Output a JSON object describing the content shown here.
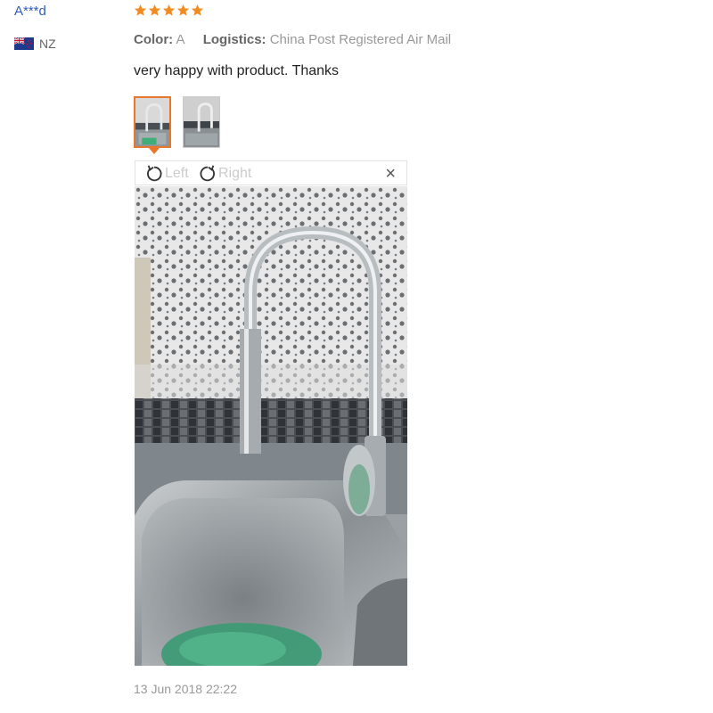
{
  "reviewer": {
    "name": "A***d",
    "country_code": "NZ",
    "flag_icon": "nz-flag-icon"
  },
  "review": {
    "rating": 5,
    "rating_max": 5,
    "star_color": "#f08c24",
    "color_label": "Color:",
    "color_value": "A",
    "logistics_label": "Logistics:",
    "logistics_value": "China Post Registered Air Mail",
    "text": "very happy with product. Thanks",
    "date": "13 Jun 2018 22:22"
  },
  "viewer": {
    "rotate_left_label": "Left",
    "rotate_right_label": "Right",
    "close_label": "×",
    "selected_thumbnail": 1,
    "thumbnail_count": 2,
    "accent_color": "#e8772c"
  }
}
